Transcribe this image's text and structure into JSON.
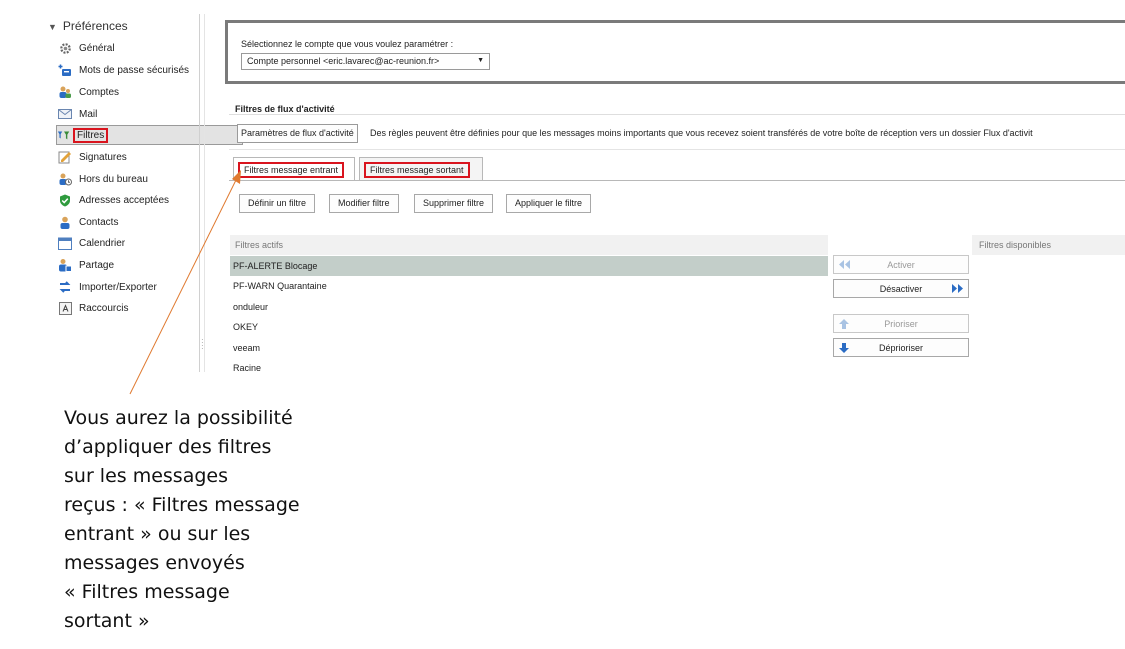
{
  "sidebar": {
    "header": "Préférences",
    "items": [
      {
        "label": "Général",
        "icon": "gear-icon"
      },
      {
        "label": "Mots de passe sécurisés",
        "icon": "key-plus-icon"
      },
      {
        "label": "Comptes",
        "icon": "accounts-icon"
      },
      {
        "label": "Mail",
        "icon": "mail-icon"
      },
      {
        "label": "Filtres",
        "icon": "filter-icon",
        "selected": true
      },
      {
        "label": "Signatures",
        "icon": "signature-icon"
      },
      {
        "label": "Hors du bureau",
        "icon": "out-of-office-icon"
      },
      {
        "label": "Adresses acceptées",
        "icon": "shield-check-icon"
      },
      {
        "label": "Contacts",
        "icon": "contact-icon"
      },
      {
        "label": "Calendrier",
        "icon": "calendar-icon"
      },
      {
        "label": "Partage",
        "icon": "share-icon"
      },
      {
        "label": "Importer/Exporter",
        "icon": "import-export-icon"
      },
      {
        "label": "Raccourcis",
        "icon": "shortcut-icon"
      }
    ]
  },
  "account": {
    "label": "Sélectionnez le compte que vous voulez paramétrer :",
    "selected": "Compte personnel <eric.lavarec@ac-reunion.fr>"
  },
  "flux": {
    "title": "Filtres de flux d'activité",
    "button": "Paramètres de flux d'activité",
    "description": "Des règles peuvent être définies pour que les messages moins importants que vous recevez soient transférés de votre boîte de réception vers un dossier Flux d'activit"
  },
  "tabs": [
    {
      "label": "Filtres message entrant",
      "active": true
    },
    {
      "label": "Filtres message sortant",
      "active": false
    }
  ],
  "actions": {
    "define": "Définir un filtre",
    "modify": "Modifier filtre",
    "delete": "Supprimer filtre",
    "apply": "Appliquer le filtre"
  },
  "active_filters": {
    "header": "Filtres actifs",
    "rows": [
      "PF-ALERTE Blocage",
      "PF-WARN Quarantaine",
      "onduleur",
      "OKEY",
      "veeam",
      "Racine"
    ]
  },
  "available_filters": {
    "header": "Filtres disponibles"
  },
  "move_buttons": {
    "activate": "Activer",
    "deactivate": "Désactiver",
    "prioritize": "Prioriser",
    "deprioritize": "Déprioriser"
  },
  "caption": {
    "lines": [
      "Vous aurez la possibilité",
      "d’appliquer des filtres",
      "sur les messages",
      "reçus : « Filtres message",
      "entrant » ou sur les",
      "messages envoyés",
      "« Filtres message",
      "sortant »"
    ]
  },
  "colors": {
    "highlight": "#d9141e",
    "annotation": "#e07a30",
    "selected_row": "#c3cec9",
    "icon_blue": "#2b6cc4"
  }
}
